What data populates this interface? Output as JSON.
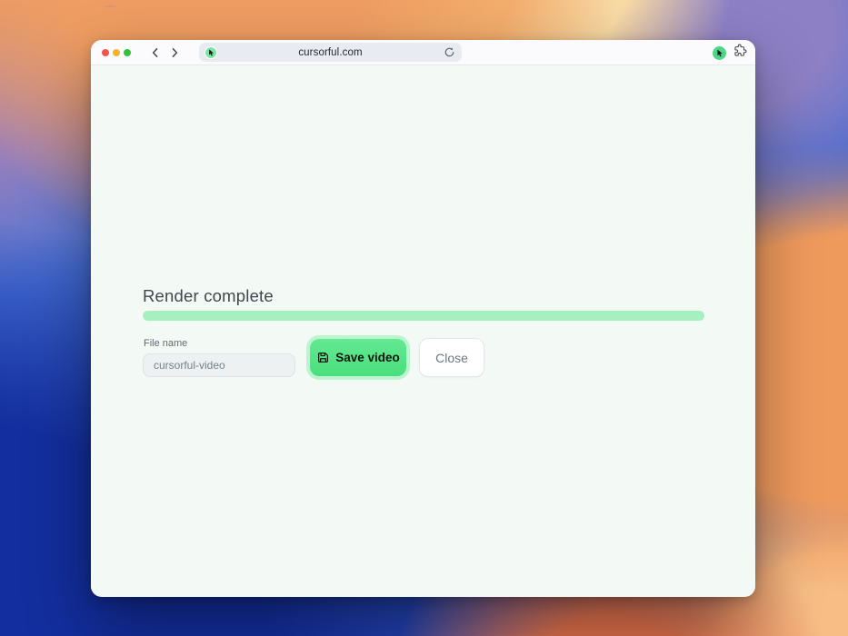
{
  "browser": {
    "url": "cursorful.com",
    "traffic_lights": [
      "close",
      "minimize",
      "zoom"
    ],
    "icons": {
      "back": "chevron-left-icon",
      "forward": "chevron-right-icon",
      "reload": "reload-icon",
      "favicon": "cursorful-cursor-icon",
      "extension": "cursorful-extension-icon",
      "extensions_menu": "puzzle-piece-icon"
    }
  },
  "page": {
    "heading": "Render complete",
    "progress": {
      "percent": 100,
      "fill_color": "#a6efbe"
    },
    "form": {
      "file_name_label": "File name",
      "file_name_value": "cursorful-video"
    },
    "buttons": {
      "save_label": "Save video",
      "close_label": "Close"
    }
  },
  "colors": {
    "accent_green": "#52e283",
    "save_ring": "#bcf4cf",
    "page_background": "#f3f9f5"
  }
}
